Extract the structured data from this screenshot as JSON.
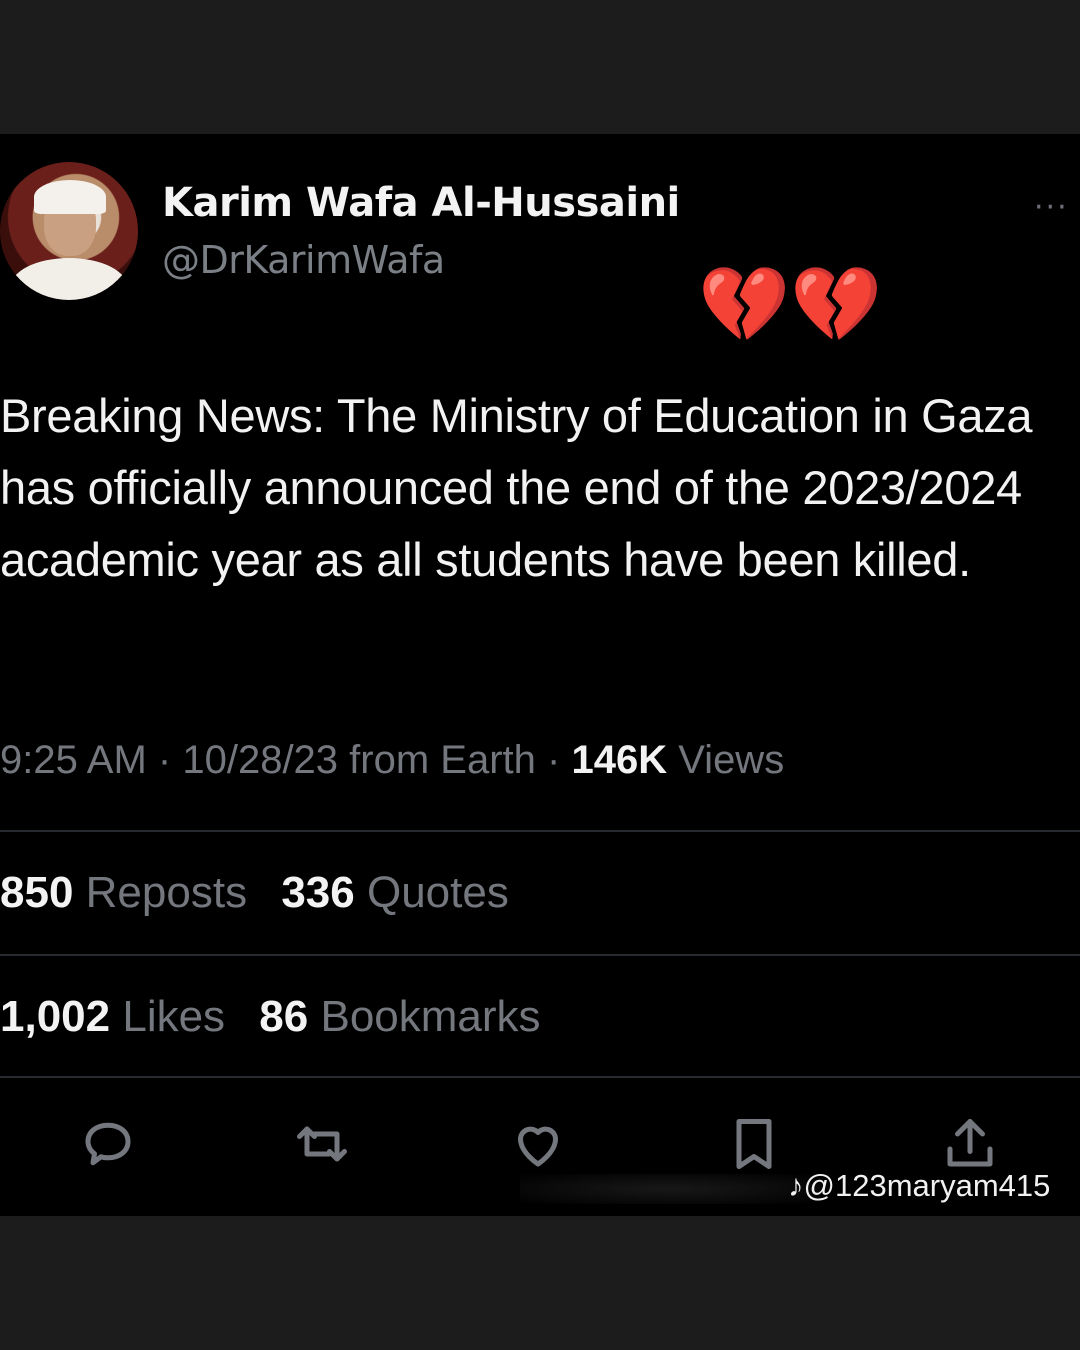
{
  "tweet": {
    "author_name": "Karim Wafa Al-Hussaini",
    "handle": "@DrKarimWafa",
    "more_label": "···",
    "emoji": "💔💔",
    "text": "Breaking News: The Ministry of Education in Gaza has officially announced the end of the 2023/2024 academic year as all students have been killed.",
    "time": "9:25 AM",
    "date_source": "10/28/23 from Earth",
    "separator": "·",
    "views_count": "146K",
    "views_label": "Views",
    "reposts_count": "850",
    "reposts_label": "Reposts",
    "quotes_count": "336",
    "quotes_label": "Quotes",
    "likes_count": "1,002",
    "likes_label": "Likes",
    "bookmarks_count": "86",
    "bookmarks_label": "Bookmarks"
  },
  "actions": [
    "reply-icon",
    "repost-icon",
    "like-icon",
    "bookmark-icon",
    "share-icon"
  ],
  "watermark": "@123maryam415",
  "colors": {
    "background": "#000000",
    "frame": "#1c1c1c",
    "text_primary": "#f3f3f3",
    "text_secondary": "#74787e",
    "divider": "#262a2e"
  }
}
